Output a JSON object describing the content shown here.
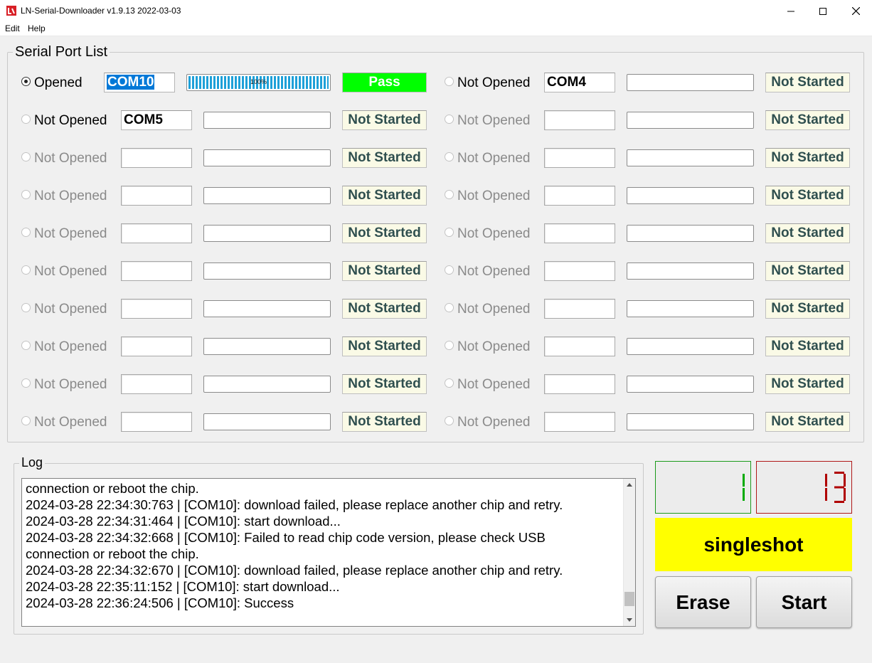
{
  "window": {
    "title": "LN-Serial-Downloader v1.9.13 2022-03-03",
    "icons": {
      "app": "app-logo-icon",
      "minimize": "minimize-icon",
      "maximize": "maximize-icon",
      "close": "close-icon"
    }
  },
  "menu": {
    "items": [
      "Edit",
      "Help"
    ]
  },
  "serial_port_list": {
    "title": "Serial Port List",
    "ports": [
      {
        "state": "Opened",
        "checked": true,
        "active": true,
        "port": "COM10",
        "port_selected": true,
        "progress_percent": 100,
        "progress_label": "100%",
        "status": "Pass"
      },
      {
        "state": "Not Opened",
        "checked": false,
        "active": true,
        "port": "COM4",
        "port_selected": false,
        "progress_percent": 0,
        "progress_label": "",
        "status": "Not Started"
      },
      {
        "state": "Not Opened",
        "checked": false,
        "active": true,
        "port": "COM5",
        "port_selected": false,
        "progress_percent": 0,
        "progress_label": "",
        "status": "Not Started"
      },
      {
        "state": "Not Opened",
        "checked": false,
        "active": false,
        "port": "",
        "port_selected": false,
        "progress_percent": 0,
        "progress_label": "",
        "status": "Not Started"
      },
      {
        "state": "Not Opened",
        "checked": false,
        "active": false,
        "port": "",
        "port_selected": false,
        "progress_percent": 0,
        "progress_label": "",
        "status": "Not Started"
      },
      {
        "state": "Not Opened",
        "checked": false,
        "active": false,
        "port": "",
        "port_selected": false,
        "progress_percent": 0,
        "progress_label": "",
        "status": "Not Started"
      },
      {
        "state": "Not Opened",
        "checked": false,
        "active": false,
        "port": "",
        "port_selected": false,
        "progress_percent": 0,
        "progress_label": "",
        "status": "Not Started"
      },
      {
        "state": "Not Opened",
        "checked": false,
        "active": false,
        "port": "",
        "port_selected": false,
        "progress_percent": 0,
        "progress_label": "",
        "status": "Not Started"
      },
      {
        "state": "Not Opened",
        "checked": false,
        "active": false,
        "port": "",
        "port_selected": false,
        "progress_percent": 0,
        "progress_label": "",
        "status": "Not Started"
      },
      {
        "state": "Not Opened",
        "checked": false,
        "active": false,
        "port": "",
        "port_selected": false,
        "progress_percent": 0,
        "progress_label": "",
        "status": "Not Started"
      },
      {
        "state": "Not Opened",
        "checked": false,
        "active": false,
        "port": "",
        "port_selected": false,
        "progress_percent": 0,
        "progress_label": "",
        "status": "Not Started"
      },
      {
        "state": "Not Opened",
        "checked": false,
        "active": false,
        "port": "",
        "port_selected": false,
        "progress_percent": 0,
        "progress_label": "",
        "status": "Not Started"
      },
      {
        "state": "Not Opened",
        "checked": false,
        "active": false,
        "port": "",
        "port_selected": false,
        "progress_percent": 0,
        "progress_label": "",
        "status": "Not Started"
      },
      {
        "state": "Not Opened",
        "checked": false,
        "active": false,
        "port": "",
        "port_selected": false,
        "progress_percent": 0,
        "progress_label": "",
        "status": "Not Started"
      },
      {
        "state": "Not Opened",
        "checked": false,
        "active": false,
        "port": "",
        "port_selected": false,
        "progress_percent": 0,
        "progress_label": "",
        "status": "Not Started"
      },
      {
        "state": "Not Opened",
        "checked": false,
        "active": false,
        "port": "",
        "port_selected": false,
        "progress_percent": 0,
        "progress_label": "",
        "status": "Not Started"
      },
      {
        "state": "Not Opened",
        "checked": false,
        "active": false,
        "port": "",
        "port_selected": false,
        "progress_percent": 0,
        "progress_label": "",
        "status": "Not Started"
      },
      {
        "state": "Not Opened",
        "checked": false,
        "active": false,
        "port": "",
        "port_selected": false,
        "progress_percent": 0,
        "progress_label": "",
        "status": "Not Started"
      },
      {
        "state": "Not Opened",
        "checked": false,
        "active": false,
        "port": "",
        "port_selected": false,
        "progress_percent": 0,
        "progress_label": "",
        "status": "Not Started"
      },
      {
        "state": "Not Opened",
        "checked": false,
        "active": false,
        "port": "",
        "port_selected": false,
        "progress_percent": 0,
        "progress_label": "",
        "status": "Not Started"
      }
    ]
  },
  "log": {
    "title": "Log",
    "lines": [
      "connection or reboot the chip.",
      "2024-03-28 22:34:30:763 | [COM10]: download failed, please replace another chip and retry.",
      "2024-03-28 22:34:31:464 | [COM10]: start download...",
      "2024-03-28 22:34:32:668 | [COM10]: Failed to read chip code version, please check USB",
      "connection or reboot the chip.",
      "2024-03-28 22:34:32:670 | [COM10]: download failed, please replace another chip and retry.",
      "2024-03-28 22:35:11:152 | [COM10]: start download...",
      "2024-03-28 22:36:24:506 | [COM10]: Success"
    ],
    "scroll_position": 0.93
  },
  "counters": {
    "success": {
      "value": "1",
      "color": "#00aa00"
    },
    "total": {
      "value": "13",
      "color": "#b00000"
    }
  },
  "mode": {
    "label": "singleshot",
    "color": "#ffff00"
  },
  "buttons": {
    "erase": "Erase",
    "start": "Start"
  },
  "colors": {
    "pass": "#00ff00",
    "not_started_bg": "#fafae6",
    "not_started_text": "#2f4f4f",
    "progress": "#1ea0d8"
  }
}
